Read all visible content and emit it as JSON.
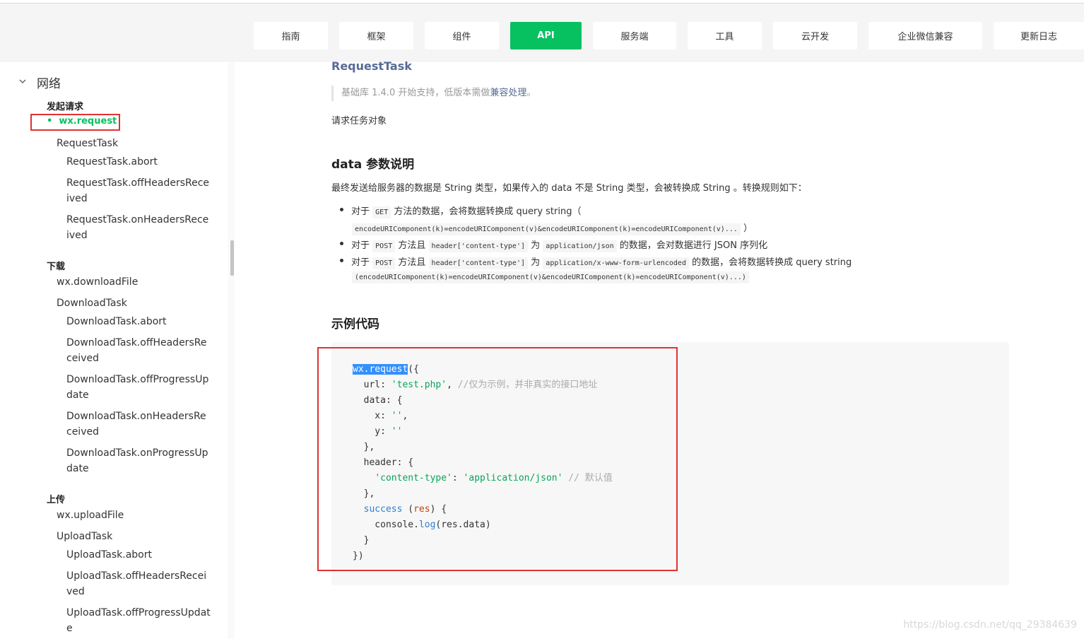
{
  "nav": {
    "items": [
      {
        "label": "指南",
        "active": false
      },
      {
        "label": "框架",
        "active": false
      },
      {
        "label": "组件",
        "active": false
      },
      {
        "label": "API",
        "active": true
      },
      {
        "label": "服务端",
        "active": false
      },
      {
        "label": "工具",
        "active": false
      },
      {
        "label": "云开发",
        "active": false
      },
      {
        "label": "企业微信兼容",
        "active": false
      },
      {
        "label": "更新日志",
        "active": false
      }
    ],
    "accent_color": "#07c160"
  },
  "sidebar": {
    "section": "网络",
    "groups": [
      {
        "title": "发起请求",
        "active_item": "wx.request",
        "items": [
          "RequestTask"
        ],
        "subitems": [
          "RequestTask.abort",
          "RequestTask.offHeadersReceived",
          "RequestTask.onHeadersReceived"
        ]
      },
      {
        "title": "下载",
        "items": [
          "wx.downloadFile",
          "DownloadTask"
        ],
        "subitems": [
          "DownloadTask.abort",
          "DownloadTask.offHeadersReceived",
          "DownloadTask.offProgressUpdate",
          "DownloadTask.onHeadersReceived",
          "DownloadTask.onProgressUpdate"
        ]
      },
      {
        "title": "上传",
        "items": [
          "wx.uploadFile",
          "UploadTask"
        ],
        "subitems": [
          "UploadTask.abort",
          "UploadTask.offHeadersReceived",
          "UploadTask.offProgressUpdate"
        ]
      }
    ]
  },
  "content": {
    "title": "RequestTask",
    "note_prefix": "基础库 1.4.0 开始支持，低版本需做",
    "note_link": "兼容处理",
    "note_suffix": "。",
    "description": "请求任务对象",
    "data_heading": "data 参数说明",
    "data_desc": "最终发送给服务器的数据是 String 类型，如果传入的 data 不是 String 类型，会被转换成 String 。转换规则如下：",
    "rule1_a": "对于",
    "rule1_code": "GET",
    "rule1_b": "方法的数据，会将数据转换成 query string（",
    "rule1_line2": "encodeURIComponent(k)=encodeURIComponent(v)&encodeURIComponent(k)=encodeURIComponent(v)...",
    "rule1_close": "）",
    "rule2_a": "对于",
    "rule2_code1": "POST",
    "rule2_b": "方法且",
    "rule2_code2": "header['content-type']",
    "rule2_c": "为",
    "rule2_code3": "application/json",
    "rule2_d": "的数据，会对数据进行 JSON 序列化",
    "rule3_a": "对于",
    "rule3_code1": "POST",
    "rule3_b": "方法且",
    "rule3_code2": "header['content-type']",
    "rule3_c": "为",
    "rule3_code3": "application/x-www-form-urlencoded",
    "rule3_d": "的数据，会将数据转换成 query string",
    "rule3_line2": "(encodeURIComponent(k)=encodeURIComponent(v)&encodeURIComponent(k)=encodeURIComponent(v)...)",
    "example_heading": "示例代码"
  },
  "code": {
    "l1_sel": "wx.request",
    "l1_rest": "({",
    "l2_key": "  url: ",
    "l2_str": "'test.php'",
    "l2_comma": ", ",
    "l2_cmt": "//仅为示例，并非真实的接口地址",
    "l3": "  data: {",
    "l4_key": "    x: ",
    "l4_str": "''",
    "l4_comma": ",",
    "l5_key": "    y: ",
    "l5_str": "''",
    "l6": "  },",
    "l7": "  header: {",
    "l8_str1": "'content-type'",
    "l8_colon": ": ",
    "l8_str2": "'application/json'",
    "l8_cmt": " // 默认值",
    "l9": "  },",
    "l10_fn": "success",
    "l10_open": " (",
    "l10_arg": "res",
    "l10_close": ") {",
    "l11_a": "    console.",
    "l11_fn": "log",
    "l11_b": "(res.data)",
    "l12": "  }",
    "l13": "})"
  },
  "watermark": "https://blog.csdn.net/qq_29384639"
}
